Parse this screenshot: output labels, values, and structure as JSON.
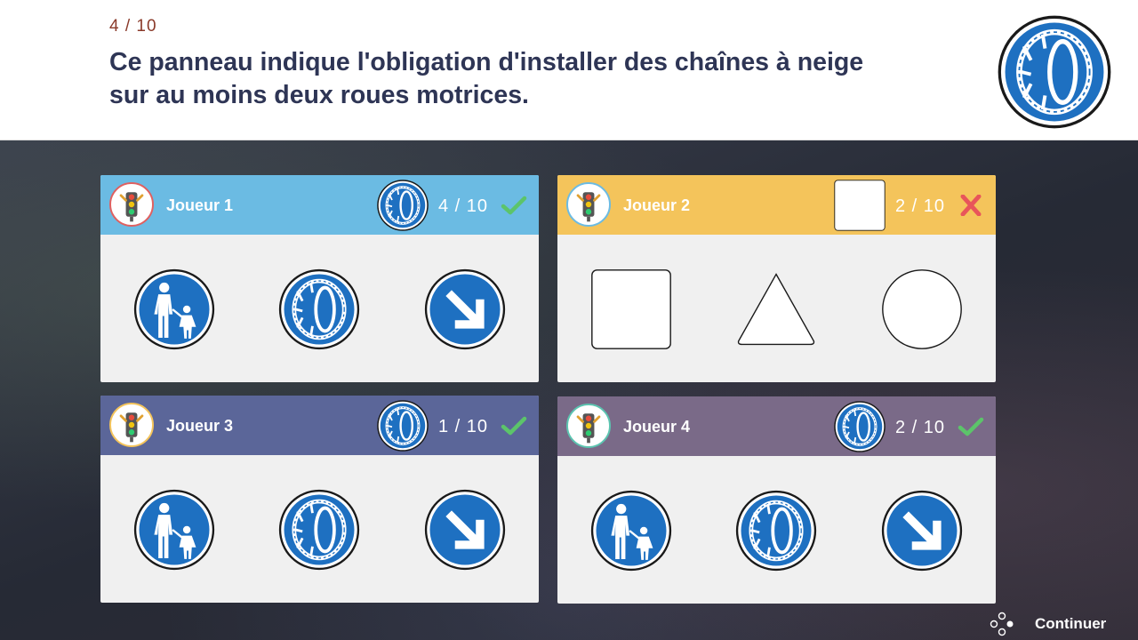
{
  "question": {
    "counter": "4 / 10",
    "text": "Ce panneau indique l'obligation d'installer des chaînes à neige sur au moins deux roues motrices.",
    "sign_icon": "snow-chains-sign"
  },
  "players": [
    {
      "name": "Joueur 1",
      "score": "4 / 10",
      "result": "correct",
      "header_color": "#6bbbe3",
      "answer_icon": "snow-chains-sign",
      "options": [
        "pedestrian-path-sign",
        "snow-chains-sign",
        "keep-right-arrow-sign"
      ]
    },
    {
      "name": "Joueur 2",
      "score": "2 / 10",
      "result": "wrong",
      "header_color": "#f4c45b",
      "answer_icon": "blank-square",
      "options": [
        "blank-square-shape",
        "blank-triangle-shape",
        "blank-circle-shape"
      ]
    },
    {
      "name": "Joueur 3",
      "score": "1 / 10",
      "result": "correct",
      "header_color": "#5b6699",
      "answer_icon": "snow-chains-sign",
      "options": [
        "pedestrian-path-sign",
        "snow-chains-sign",
        "keep-right-arrow-sign"
      ]
    },
    {
      "name": "Joueur 4",
      "score": "2 / 10",
      "result": "correct",
      "header_color": "#7a6a88",
      "answer_icon": "snow-chains-sign",
      "options": [
        "pedestrian-path-sign",
        "snow-chains-sign",
        "keep-right-arrow-sign"
      ]
    }
  ],
  "footer": {
    "continue_label": "Continuer"
  },
  "colors": {
    "sign_blue": "#1e70c1",
    "check_green": "#5cc46a",
    "cross_red": "#e8555a",
    "title": "#2e3555"
  }
}
